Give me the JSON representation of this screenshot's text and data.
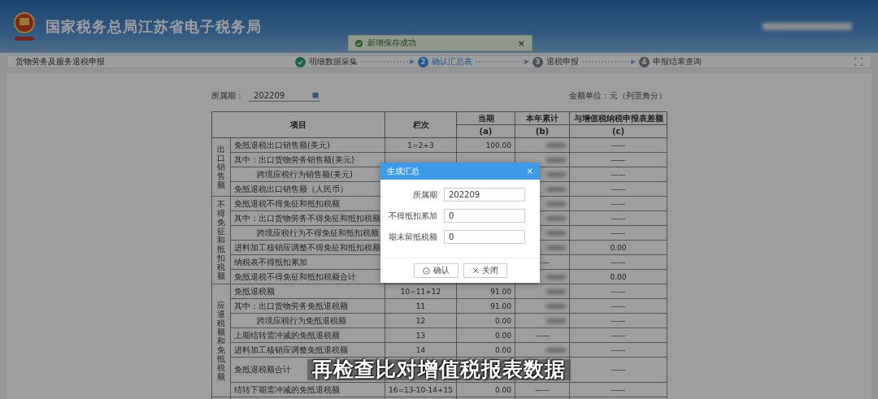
{
  "header": {
    "title": "国家税务总局江苏省电子税务局"
  },
  "toast": {
    "message": "新增保存成功",
    "close": "×"
  },
  "nav": {
    "title": "货物劳务及服务退税申报",
    "steps": [
      {
        "label": "明细数据采集",
        "done": true,
        "selected": false
      },
      {
        "number": "2",
        "label": "确认汇总表",
        "done": false,
        "selected": true
      },
      {
        "number": "3",
        "label": "退税申报",
        "done": false,
        "selected": false
      },
      {
        "number": "4",
        "label": "申报结果查询",
        "done": false,
        "selected": false
      }
    ]
  },
  "filter": {
    "label": "所属期：",
    "value": "202209",
    "unit": "金额单位：元（列至角分）"
  },
  "table": {
    "columns": [
      {
        "label": "项目"
      },
      {
        "label": "栏次"
      },
      {
        "label": "当期",
        "sub": "(a)"
      },
      {
        "label": "本年累计",
        "sub": "(b)"
      },
      {
        "label": "与增值税纳税申报表差额",
        "sub": "(c)"
      }
    ],
    "groups": [
      {
        "label": "出口销售额",
        "rows": [
          {
            "item": "免抵退税出口销售额(美元)",
            "kind": "main",
            "line": "1=2+3",
            "a": "100.00",
            "b_blurred": true,
            "c": "——"
          },
          {
            "item": "其中：出口货物劳务销售额(美元)",
            "kind": "detail",
            "b_blurred": true,
            "c": "——"
          },
          {
            "item": "跨境应税行为销售额(美元)",
            "kind": "nested",
            "b_blurred": true,
            "c": "——"
          },
          {
            "item": "免抵退税出口销售额（人民币）",
            "kind": "main",
            "b_blurred": true,
            "c": "——"
          }
        ]
      },
      {
        "label": "不得免征和抵扣税额",
        "rows": [
          {
            "item": "免抵退税不得免征和抵扣税额",
            "kind": "main",
            "b_blurred": true,
            "c": "——"
          },
          {
            "item": "其中：出口货物劳务不得免征和抵扣税额",
            "kind": "detail",
            "b_blurred": true,
            "c": "——"
          },
          {
            "item": "跨境应税行为不得免征和抵扣税额",
            "kind": "nested",
            "b_blurred": true,
            "c": "——"
          },
          {
            "item": "进料加工核销应调整不得免征和抵扣税额",
            "kind": "main",
            "b_blurred": true,
            "c": "0.00"
          },
          {
            "item": "纳税表不得抵扣累加",
            "kind": "main",
            "b_blurred": false,
            "b": "——",
            "c": "——"
          },
          {
            "item": "免抵退税不得免征和抵扣税额合计",
            "kind": "main",
            "b_blurred": true,
            "c": "0.00"
          }
        ]
      },
      {
        "label": "应退税额和免抵税额",
        "rows": [
          {
            "item": "免抵退税额",
            "kind": "main",
            "line": "10=11+12",
            "a": "91.00",
            "b_blurred": true,
            "c": "——"
          },
          {
            "item": "其中：出口货物劳务免抵退税额",
            "kind": "detail",
            "line": "11",
            "a": "91.00",
            "b_blurred": true,
            "c": "——"
          },
          {
            "item": "跨境应税行为免抵退税额",
            "kind": "nested",
            "line": "12",
            "a": "0.00",
            "b_blurred": true,
            "c": "——"
          },
          {
            "item": "上期结转需冲减的免抵退税额",
            "kind": "main",
            "line": "13",
            "a": "0.00",
            "b_blurred": false,
            "b": "——",
            "c": "——"
          },
          {
            "item": "进料加工核销应调整免抵退税额",
            "kind": "main",
            "line": "14",
            "a": "0.00",
            "b_blurred": true,
            "c": "——"
          },
          {
            "item": "免抵退税额合计",
            "kind": "tall",
            "b_blurred": false,
            "c": "——"
          },
          {
            "item": "结转下期需冲减的免抵退税额",
            "kind": "main",
            "line": "16=13-10-14+15",
            "a": "0.00",
            "b_blurred": false,
            "b": "——",
            "c": "——"
          }
        ]
      }
    ]
  },
  "modal": {
    "title": "生成汇总",
    "close": "×",
    "fields": [
      {
        "label": "所属期",
        "value": "202209"
      },
      {
        "label": "不得抵扣累加",
        "value": "0"
      },
      {
        "label": "期末留抵税额",
        "value": "0"
      }
    ],
    "buttons": [
      {
        "label": "确认",
        "kind": "confirm"
      },
      {
        "label": "关闭",
        "kind": "close"
      }
    ]
  },
  "subtitle": "再检查比对增值税报表数据"
}
